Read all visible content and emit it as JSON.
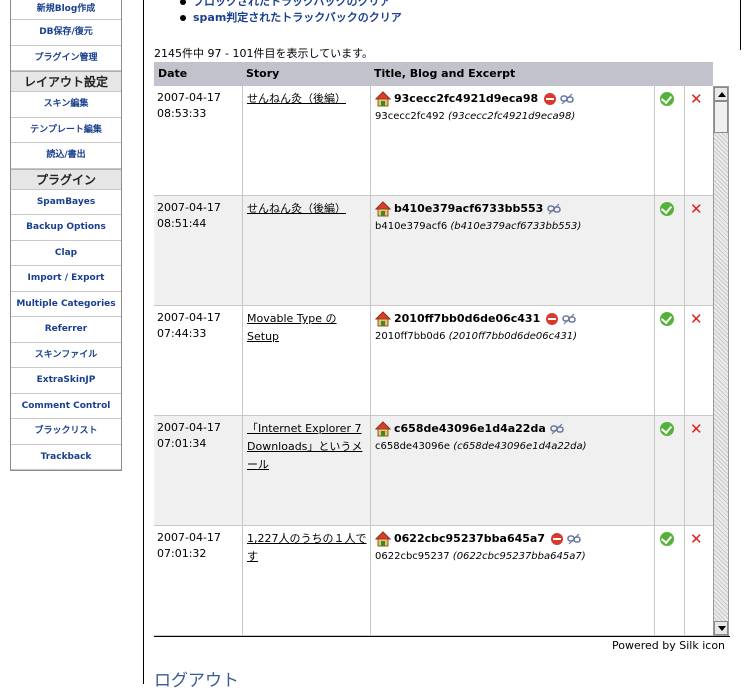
{
  "sidebar": {
    "items_top": [
      "新規Blog作成",
      "DB保存/復元",
      "プラグイン管理"
    ],
    "layout_header": "レイアウト設定",
    "layout_items": [
      "スキン編集",
      "テンプレート編集",
      "読込/書出"
    ],
    "plugin_header": "プラグイン",
    "plugin_items": [
      "SpamBayes",
      "Backup Options",
      "Clap",
      "Import / Export",
      "Multiple Categories",
      "Referrer",
      "スキンファイル",
      "ExtraSkinJP",
      "Comment Control",
      "ブラックリスト",
      "Trackback"
    ]
  },
  "bullets": [
    "ブロックされたトラックバックのクリア",
    "spam判定されたトラックバックのクリア"
  ],
  "count_text": "2145件中 97 - 101件目を表示しています。",
  "table": {
    "headers": {
      "date": "Date",
      "story": "Story",
      "title": "Title, Blog and Excerpt"
    },
    "rows": [
      {
        "date1": "2007-04-17",
        "date2": "08:53:33",
        "story": "せんねん灸（後編）",
        "title": "93cecc2fc4921d9eca98",
        "blog": "93cecc2fc492",
        "excerpt": "(93cecc2fc4921d9eca98)",
        "has_delete": true
      },
      {
        "date1": "2007-04-17",
        "date2": "08:51:44",
        "story": "せんねん灸（後編）",
        "title": "b410e379acf6733bb553",
        "blog": "b410e379acf6",
        "excerpt": "(b410e379acf6733bb553)",
        "has_delete": false
      },
      {
        "date1": "2007-04-17",
        "date2": "07:44:33",
        "story": "Movable Type の Setup",
        "title": "2010ff7bb0d6de06c431",
        "blog": "2010ff7bb0d6",
        "excerpt": "(2010ff7bb0d6de06c431)",
        "has_delete": true
      },
      {
        "date1": "2007-04-17",
        "date2": "07:01:34",
        "story": "「Internet Explorer 7 Downloads」というメール",
        "title": "c658de43096e1d4a22da",
        "blog": "c658de43096e",
        "excerpt": "(c658de43096e1d4a22da)",
        "has_delete": false
      },
      {
        "date1": "2007-04-17",
        "date2": "07:01:32",
        "story": "1,227人のうちの１人です",
        "title": "0622cbc95237bba645a7",
        "blog": "0622cbc95237",
        "excerpt": "(0622cbc95237bba645a7)",
        "has_delete": true
      }
    ]
  },
  "powered": {
    "prefix": "Powered by ",
    "link": "Silk icon"
  },
  "logout": "ログアウト"
}
